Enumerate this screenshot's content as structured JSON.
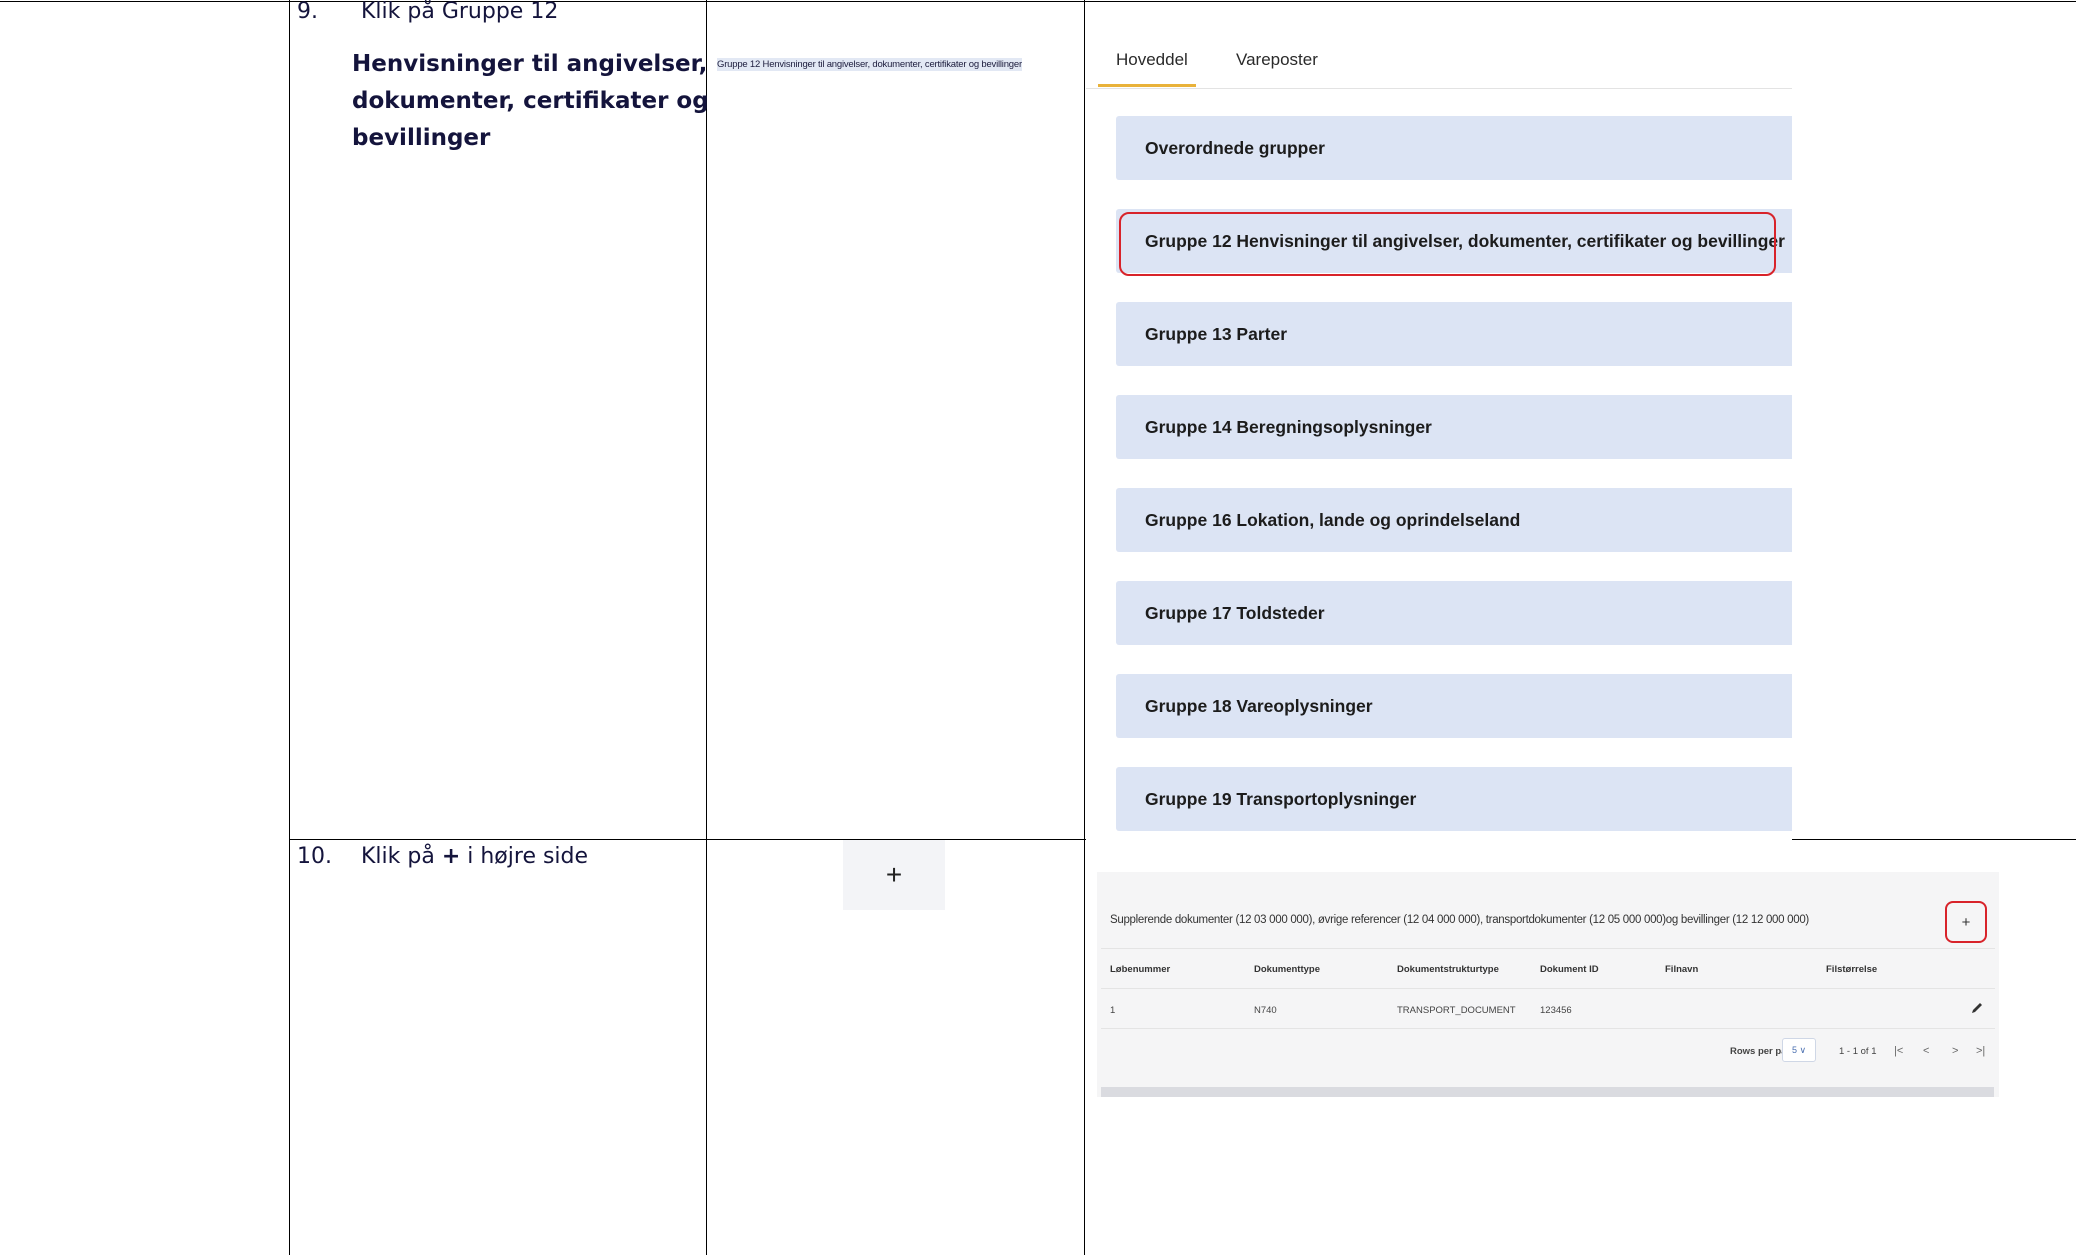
{
  "step9": {
    "number": "9.",
    "text": "Klik på Gruppe 12",
    "bold_lines": [
      "Henvisninger til angivelser,",
      "dokumenter, certifikater og",
      "bevillinger"
    ]
  },
  "step10": {
    "number": "10.",
    "text_before": "Klik på ",
    "text_bold": "+",
    "text_after": " i højre side"
  },
  "mini_label": "Gruppe 12 Henvisninger til angivelser, dokumenter, certifikater og bevillinger",
  "plus_button_label": "+",
  "screenshot1": {
    "tabs": [
      "Hoveddel",
      "Vareposter"
    ],
    "active_tab": "Hoveddel",
    "groups": [
      "Overordnede grupper",
      "Gruppe 12 Henvisninger til angivelser, dokumenter, certifikater og bevillinger",
      "Gruppe 13 Parter",
      "Gruppe 14 Beregningsoplysninger",
      "Gruppe 16 Lokation, lande og oprindelseland",
      "Gruppe 17 Toldsteder",
      "Gruppe 18 Vareoplysninger",
      "Gruppe 19 Transportoplysninger"
    ],
    "highlight_color": "#d8232a",
    "accent_color": "#e9b23a",
    "group_bg": "#dce4f4"
  },
  "screenshot2": {
    "description": "Supplerende dokumenter (12 03 000 000), øvrige referencer (12 04 000 000), transportdokumenter (12 05 000 000)og bevillinger (12 12 000 000)",
    "add_label": "+",
    "columns": [
      "Løbenummer",
      "Dokumenttype",
      "Dokumentstrukturtype",
      "Dokument ID",
      "Filnavn",
      "Filstørrelse"
    ],
    "rows": [
      [
        "1",
        "N740",
        "TRANSPORT_DOCUMENT",
        "123456",
        "",
        ""
      ]
    ],
    "rows_per_page_label": "Rows per page",
    "rows_per_page_value": "5 ∨",
    "range_label": "1 - 1 of 1",
    "nav_icons": [
      "first-page-icon",
      "prev-page-icon",
      "next-page-icon",
      "last-page-icon"
    ]
  }
}
